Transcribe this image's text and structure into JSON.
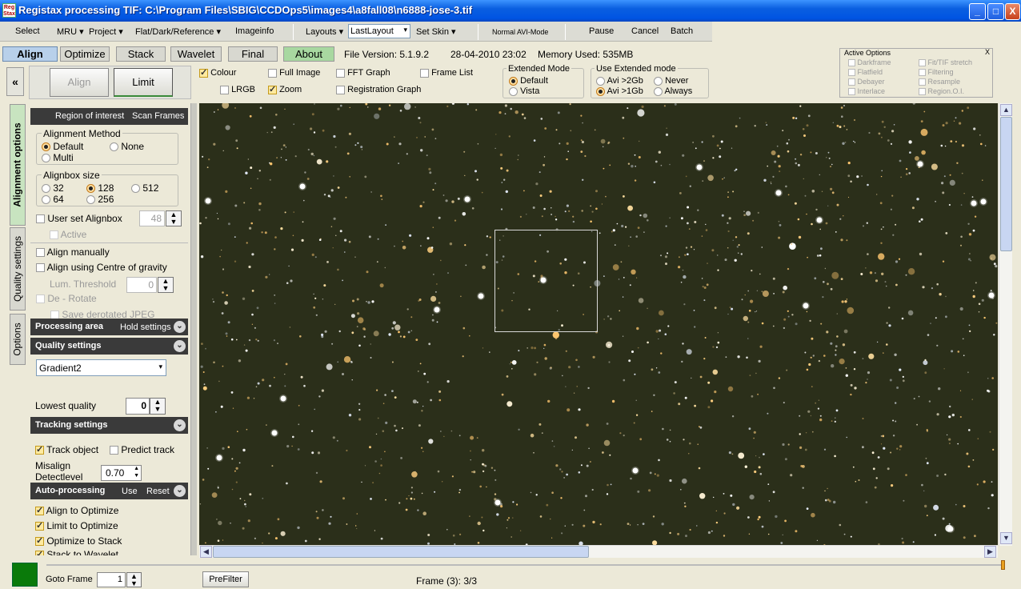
{
  "window": {
    "app_icon": "Reg\nStax",
    "title": "Registax processing TIF: C:\\Program Files\\SBIG\\CCDOps5\\images4\\a8fall08\\n6888-jose-3.tif",
    "minimize": "_",
    "maximize": "□",
    "close": "X"
  },
  "menu": {
    "select": "Select",
    "mru": "MRU ▾",
    "project": "Project ▾",
    "flat": "Flat/Dark/Reference ▾",
    "imageinfo": "Imageinfo",
    "layouts": "Layouts ▾",
    "layout_value": "LastLayout",
    "set_skin": "Set Skin ▾",
    "normal_avi": "Normal AVI-Mode",
    "pause": "Pause",
    "cancel": "Cancel",
    "batch": "Batch"
  },
  "tabs": [
    "Align",
    "Optimize",
    "Stack",
    "Wavelet",
    "Final",
    "About"
  ],
  "info": {
    "file_version": "File Version: 5.1.9.2",
    "date": "28-04-2010 23:02",
    "memory": "Memory Used: 535MB"
  },
  "toolbar": {
    "collapse": "«",
    "align": "Align",
    "limit": "Limit",
    "colour": "Colour",
    "lrgb": "LRGB",
    "full_image": "Full Image",
    "zoom": "Zoom",
    "fft_graph": "FFT Graph",
    "registration_graph": "Registration Graph",
    "frame_list": "Frame List",
    "extended_mode": {
      "caption": "Extended Mode",
      "default": "Default",
      "vista": "Vista"
    },
    "use_extended": {
      "caption": "Use  Extended mode",
      "avi2gb": "Avi >2Gb",
      "avi1gb": "Avi >1Gb",
      "never": "Never",
      "always": "Always"
    }
  },
  "active_options": {
    "caption": "Active Options",
    "close": "X",
    "items": [
      "Darkframe",
      "Fit/TIF stretch",
      "Flatfield",
      "Filtering",
      "Debayer",
      "Resample",
      "Interlace",
      "Region.O.I."
    ]
  },
  "side_tabs": [
    "Alignment options",
    "Quality settings",
    "Options"
  ],
  "left_panel": {
    "roi_header": "Region of interest",
    "scan_frames": "Scan Frames",
    "alignment_method": {
      "caption": "Alignment Method",
      "default": "Default",
      "none": "None",
      "multi": "Multi"
    },
    "alignbox": {
      "caption": "Alignbox size",
      "s32": "32",
      "s128": "128",
      "s512": "512",
      "s64": "64",
      "s256": "256"
    },
    "user_set_alignbox": "User set Alignbox",
    "alignbox_value": "48",
    "active": "Active",
    "align_manually": "Align manually",
    "align_cog": "Align using Centre of gravity",
    "lum_threshold": "Lum. Threshold",
    "lum_value": "0",
    "de_rotate": "De - Rotate",
    "save_derotated": "Save derotated JPEG",
    "processing_area": "Processing area",
    "hold_settings": "Hold settings",
    "quality_settings": "Quality settings",
    "quality_method": "Gradient2",
    "lowest_quality": "Lowest quality",
    "lowest_value": "0",
    "tracking_settings": "Tracking settings",
    "track_object": "Track object",
    "predict_track": "Predict track",
    "misalign_1": "Misalign",
    "misalign_2": "Detectlevel",
    "misalign_value": "0.70",
    "auto_processing": "Auto-processing",
    "use": "Use",
    "reset": "Reset",
    "align_to_optimize": "Align to Optimize",
    "limit_to_optimize": "Limit to Optimize",
    "optimize_to_stack": "Optimize to Stack",
    "stack_to_wavelet": "Stack to Wavelet"
  },
  "bottom": {
    "goto_frame": "Goto Frame",
    "goto_value": "1",
    "prefilter": "PreFilter",
    "frame_status": "Frame (3): 3/3"
  },
  "colors": {
    "title_bar": "#0054e3",
    "status_green": "#0a7a0a",
    "section_header": "#3a3a3a",
    "sky": "#2b2f1a"
  }
}
